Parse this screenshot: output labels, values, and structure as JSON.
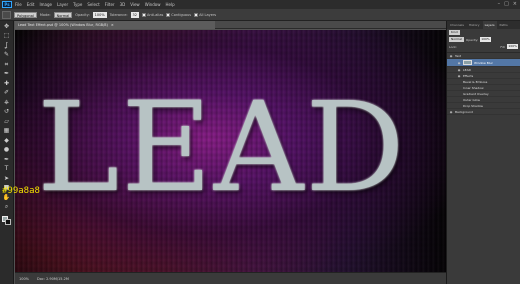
{
  "menubar": {
    "logo": "Ps",
    "items": [
      "File",
      "Edit",
      "Image",
      "Layer",
      "Type",
      "Select",
      "Filter",
      "3D",
      "View",
      "Window",
      "Help"
    ],
    "controls": [
      "–",
      "□",
      "×"
    ]
  },
  "optionsbar": {
    "selection_mode": "Polygonal",
    "mode_label": "Mode:",
    "mode_value": "Normal",
    "opacity_label": "Opacity:",
    "opacity_value": "100%",
    "tolerance_label": "Tolerance:",
    "tolerance_value": "32",
    "antialias_label": "Anti-alias",
    "contiguous_label": "Contiguous",
    "alllayers_label": "All Layers"
  },
  "document": {
    "tab_title": "Lead Text Effect.psd @ 100% (Window Blur, RGB/8)",
    "tab_close": "×",
    "canvas_text": "LEAD",
    "status_zoom": "100%",
    "status_doc": "Doc: 2.90M/15.2M"
  },
  "annotation": {
    "color_hex": "#99a8a8"
  },
  "colors": {
    "foreground": "#99a8a8",
    "background": "#111111",
    "selected_layer": "#5377a6"
  },
  "tools": [
    "move-icon",
    "marquee-icon",
    "lasso-icon",
    "quick-select-icon",
    "crop-icon",
    "eyedropper-icon",
    "healing-icon",
    "brush-icon",
    "stamp-icon",
    "history-brush-icon",
    "eraser-icon",
    "gradient-icon",
    "blur-icon",
    "dodge-icon",
    "pen-icon",
    "type-icon",
    "path-select-icon",
    "shape-icon",
    "hand-icon",
    "zoom-icon"
  ],
  "tool_glyphs": [
    "✥",
    "⬚",
    "ʆ",
    "✎",
    "⌗",
    "✒",
    "✚",
    "✐",
    "⎈",
    "↺",
    "▱",
    "▦",
    "◆",
    "●",
    "✒",
    "T",
    "➤",
    "■",
    "✋",
    "⌕"
  ],
  "panel": {
    "tabs": [
      "Channels",
      "History",
      "Layers",
      "Paths"
    ],
    "kind_label": "Kind",
    "blend_value": "Normal",
    "opacity_label": "Opacity:",
    "opacity_value": "100%",
    "lock_label": "Lock:",
    "fill_label": "Fill:",
    "fill_value": "100%",
    "layers": [
      {
        "name": "Text",
        "level": "group"
      },
      {
        "name": "Window Blur",
        "level": "sub"
      },
      {
        "name": "LEAD",
        "level": "sub"
      },
      {
        "name": "Effects",
        "level": "sub"
      },
      {
        "name": "Bevel & Emboss",
        "level": "fx"
      },
      {
        "name": "Inner Shadow",
        "level": "fx"
      },
      {
        "name": "Gradient Overlay",
        "level": "fx"
      },
      {
        "name": "Outer Glow",
        "level": "fx"
      },
      {
        "name": "Drop Shadow",
        "level": "fx"
      },
      {
        "name": "Background",
        "level": "group"
      }
    ]
  }
}
